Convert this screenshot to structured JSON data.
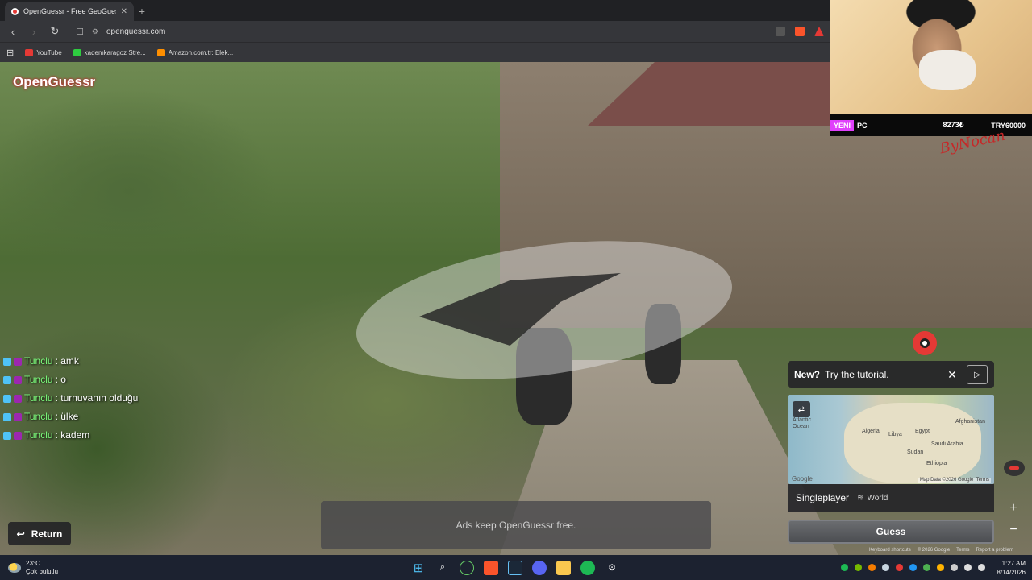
{
  "browser": {
    "tab_title": "OpenGuessr - Free GeoGuess",
    "new_tab": "+",
    "url": "openguessr.com",
    "bookmarks": [
      {
        "label": "YouTube",
        "color": "#e53935"
      },
      {
        "label": "kademkaragoz Stre...",
        "color": "#2ecc40"
      },
      {
        "label": "Amazon.com.tr: Elek...",
        "color": "#ff8f00"
      }
    ]
  },
  "game": {
    "logo": "OpenGuessr",
    "return_label": "Return",
    "ads_text": "Ads keep OpenGuessr free.",
    "tutorial": {
      "new": "New?",
      "text": "Try the tutorial."
    },
    "map": {
      "labels": [
        "Atlantic Ocean",
        "Algeria",
        "Libya",
        "Egypt",
        "Afghanistan",
        "Saudi Arabia",
        "Sudan",
        "Ethiopia"
      ],
      "attribution": "Map Data ©2026 Google",
      "terms": "Terms",
      "google": "Google"
    },
    "mode": "Singleplayer",
    "region": "World",
    "guess_label": "Guess",
    "footer": [
      "Keyboard shortcuts",
      "© 2026 Google",
      "Terms",
      "Report a problem"
    ]
  },
  "chat": [
    {
      "user": "Tunclu",
      "msg": ": amk"
    },
    {
      "user": "Tunclu",
      "msg": ": o"
    },
    {
      "user": "Tunclu",
      "msg": ": turnuvanın olduğu"
    },
    {
      "user": "Tunclu",
      "msg": ": ülke"
    },
    {
      "user": "Tunclu",
      "msg": ": kadem"
    }
  ],
  "stream": {
    "tag": "YENİ",
    "pc": "PC",
    "amount": "8273₺",
    "target": "TRY60000",
    "signature": "ByNocan"
  },
  "taskbar": {
    "temp": "23°C",
    "weather": "Çok bulutlu",
    "time": "1:27 AM",
    "date": "8/14/2026"
  }
}
